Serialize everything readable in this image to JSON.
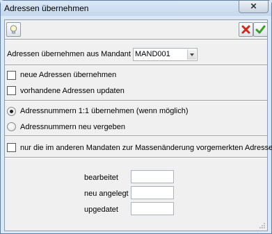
{
  "window": {
    "title": "Adressen übernehmen",
    "close_glyph": "✕"
  },
  "toolbar": {
    "icons": [
      "lightbulb-icon",
      "cancel-icon",
      "ok-icon"
    ]
  },
  "mandant": {
    "label": "Adressen übernehmen aus Mandant",
    "value": "MAND001"
  },
  "options": {
    "neue_label": "neue Adressen übernehmen",
    "update_label": "vorhandene Adressen updaten"
  },
  "numbering": {
    "keep_label": "Adressnummern  1:1 übernehmen (wenn möglich)",
    "new_label": "Adressnummern neu vergeben",
    "selected": "keep"
  },
  "filter": {
    "label": "nur die im anderen Mandaten zur Massenänderung vorgemerkten Adressen"
  },
  "stats": {
    "processed_label": "bearbeitet",
    "processed_value": "",
    "created_label": "neu angelegt",
    "created_value": "",
    "updated_label": "upgedatet",
    "updated_value": ""
  },
  "colors": {
    "accent": "#c9dcf0",
    "cancel": "#cc2a1a",
    "ok": "#3a9a2a"
  }
}
